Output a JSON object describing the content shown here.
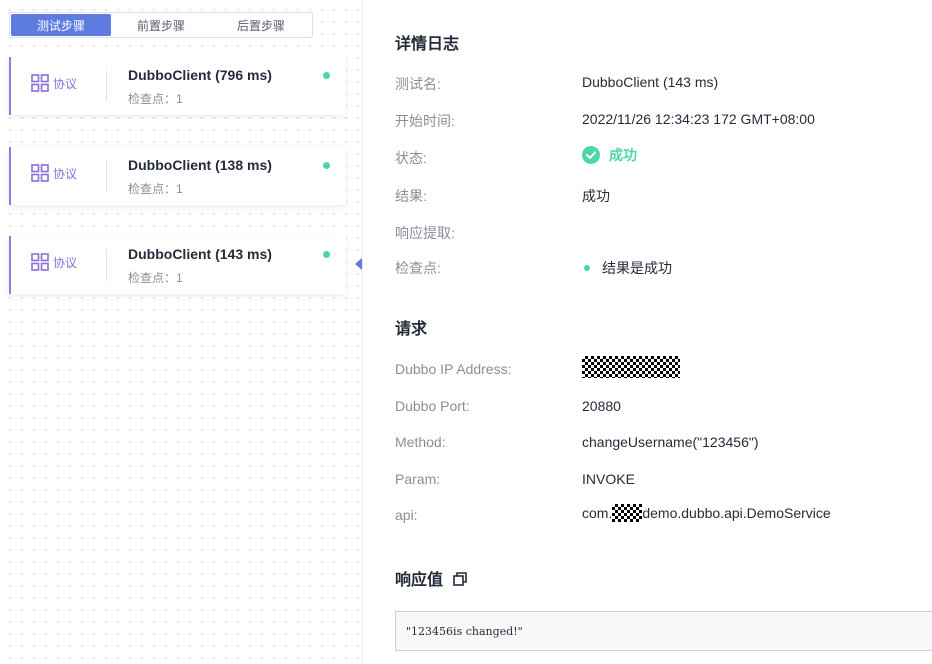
{
  "tabs": [
    {
      "label": "测试步骤",
      "active": true
    },
    {
      "label": "前置步骤",
      "active": false
    },
    {
      "label": "后置步骤",
      "active": false
    }
  ],
  "steps": [
    {
      "protocol": "协议",
      "name": "DubboClient (796 ms)",
      "checkpoints": "检查点：1",
      "status_color": "#50d4ab"
    },
    {
      "protocol": "协议",
      "name": "DubboClient (138 ms)",
      "checkpoints": "检查点：1",
      "status_color": "#50d4ab"
    },
    {
      "protocol": "协议",
      "name": "DubboClient (143 ms)",
      "checkpoints": "检查点：1",
      "status_color": "#50d4ab",
      "selected": true
    }
  ],
  "detail": {
    "title": "详情日志",
    "fields": {
      "test_name": {
        "label": "测试名:",
        "value": "DubboClient (143 ms)"
      },
      "start_time": {
        "label": "开始时间:",
        "value": "2022/11/26 12:34:23 172 GMT+08:00"
      },
      "status": {
        "label": "状态:",
        "value": "成功"
      },
      "result": {
        "label": "结果:",
        "value": "成功"
      },
      "extract": {
        "label": "响应提取:",
        "value": ""
      },
      "checkpoint": {
        "label": "检查点:",
        "value": "结果是成功"
      }
    }
  },
  "request": {
    "title": "请求",
    "fields": {
      "ip": {
        "label": "Dubbo IP Address:",
        "value": ""
      },
      "port": {
        "label": "Dubbo Port:",
        "value": "20880"
      },
      "method": {
        "label": "Method:",
        "value": "changeUsername(\"123456\")"
      },
      "param": {
        "label": "Param:",
        "value": "INVOKE"
      },
      "api": {
        "label": "api:",
        "value_prefix": "com.",
        "value_suffix": "demo.dubbo.api.DemoService"
      }
    }
  },
  "response": {
    "title": "响应值",
    "value": "\"123456is changed!\""
  },
  "colors": {
    "accent": "#5e7ce0",
    "protocol": "#8a6fd9",
    "success": "#50d4ab"
  },
  "icons": {
    "protocol": "grid-icon",
    "status": "check-circle-icon",
    "copy": "copy-icon"
  }
}
